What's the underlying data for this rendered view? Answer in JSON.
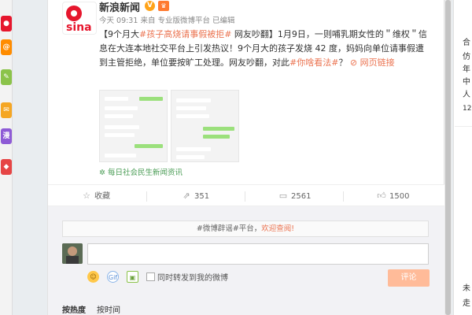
{
  "post": {
    "author": "新浪新闻",
    "verify_icon": "v-verified-icon",
    "badge_icon": "vip-badge-icon",
    "time": "今天 09:31",
    "source_prefix": "来自",
    "source": "专业版微博平台",
    "edited": "已编辑",
    "text_p1": "【9个月大",
    "text_tag1": "#孩子高烧请事假被拒#",
    "text_p2": " 网友吵翻】1月9日，一则哺乳期女性的＂维权＂信息在大连本地社交平台上引发热议！9个月大的孩子发烧 42 度，妈妈向单位请事假遭到主管拒绝，单位要按旷工处理。网友吵翻，对此",
    "text_tag2": "#你啥看法#",
    "text_p3": "？",
    "text_link": "网页链接",
    "link_icon": "link-icon",
    "topic": "每日社会民生新闻资讯",
    "topic_icon": "topic-icon"
  },
  "actions": {
    "favorite": "收藏",
    "repost": "351",
    "comment": "2561",
    "like": "1500"
  },
  "comment_box": {
    "notice_p1": "#微博辟谣#平台，",
    "notice_link": "欢迎查阅!",
    "repost_label": "同时转发到我的微博",
    "submit": "评论",
    "sort_hot": "按热度",
    "sort_time": "按时间"
  },
  "left_strip": {
    "icon_comment": "漫",
    "icon_at": "@"
  },
  "right_panel": {
    "chars": [
      "合",
      "仿",
      "年",
      "中",
      "人",
      "12",
      "",
      "",
      "",
      "",
      "",
      "未",
      "走"
    ]
  }
}
